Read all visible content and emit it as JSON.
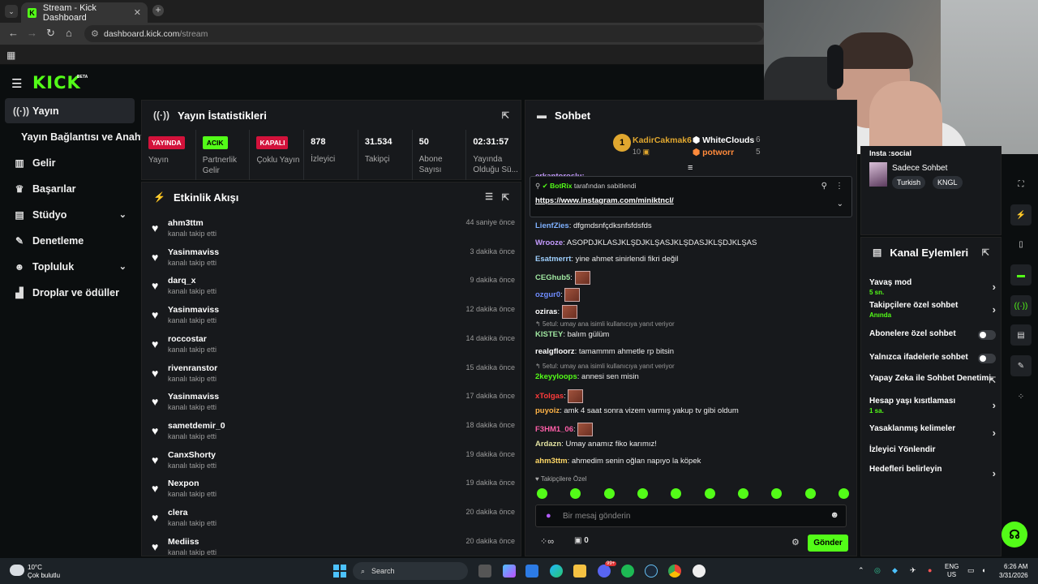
{
  "browser": {
    "tab_title": "Stream - Kick Dashboard",
    "url_host": "dashboard.kick.com",
    "url_path": "/stream"
  },
  "kick": {
    "logo": "KICK",
    "beta": "BETA"
  },
  "sidebar": {
    "items": [
      {
        "label": "Yayın",
        "icon": "broadcast-icon"
      },
      {
        "label": "Yayın Bağlantısı ve Anahtarı",
        "icon": ""
      },
      {
        "label": "Gelir",
        "icon": "chart-icon"
      },
      {
        "label": "Başarılar",
        "icon": "trophy-icon"
      },
      {
        "label": "Stüdyo",
        "icon": "studio-icon"
      },
      {
        "label": "Denetleme",
        "icon": "wrench-icon"
      },
      {
        "label": "Topluluk",
        "icon": "people-icon"
      },
      {
        "label": "Droplar ve ödüller",
        "icon": "gift-icon"
      }
    ]
  },
  "stats_panel": {
    "title": "Yayın İstatistikleri",
    "items": [
      {
        "badge": "YAYINDA",
        "label": "Yayın"
      },
      {
        "badge": "ACIK",
        "label": "Partnerlik Gelir"
      },
      {
        "badge": "KAPALI",
        "label": "Çoklu Yayın"
      },
      {
        "value": "878",
        "label": "İzleyici"
      },
      {
        "value": "31.534",
        "label": "Takipçi"
      },
      {
        "value": "50",
        "label": "Abone Sayısı"
      },
      {
        "value": "02:31:57",
        "label": "Yayında Olduğu Sü..."
      }
    ]
  },
  "activity": {
    "title": "Etkinlik Akışı",
    "items": [
      {
        "name": "ahm3ttm",
        "action": "kanalı takip etti",
        "time": "44 saniye önce"
      },
      {
        "name": "Yasinmaviss",
        "action": "kanalı takip etti",
        "time": "3 dakika önce"
      },
      {
        "name": "darq_x",
        "action": "kanalı takip etti",
        "time": "9 dakika önce"
      },
      {
        "name": "Yasinmaviss",
        "action": "kanalı takip etti",
        "time": "12 dakika önce"
      },
      {
        "name": "roccostar",
        "action": "kanalı takip etti",
        "time": "14 dakika önce"
      },
      {
        "name": "rivenranstor",
        "action": "kanalı takip etti",
        "time": "15 dakika önce"
      },
      {
        "name": "Yasinmaviss",
        "action": "kanalı takip etti",
        "time": "17 dakika önce"
      },
      {
        "name": "sametdemir_0",
        "action": "kanalı takip etti",
        "time": "18 dakika önce"
      },
      {
        "name": "CanxShorty",
        "action": "kanalı takip etti",
        "time": "19 dakika önce"
      },
      {
        "name": "Nexpon",
        "action": "kanalı takip etti",
        "time": "19 dakika önce"
      },
      {
        "name": "clera",
        "action": "kanalı takip etti",
        "time": "20 dakika önce"
      },
      {
        "name": "Mediiss",
        "action": "kanalı takip etti",
        "time": "20 dakika önce"
      }
    ]
  },
  "chat": {
    "title": "Sohbet",
    "top_gifters": [
      {
        "rank": "1",
        "name": "KadirCakmak6",
        "count": "10"
      },
      {
        "name": "WhiteClouds",
        "count": "6"
      },
      {
        "name": "potworr",
        "count": "5"
      }
    ],
    "partial_user": "erkantoroslu:",
    "pinned": {
      "author": "BotRix",
      "suffix": "tarafından sabitlendi",
      "link": "https://www.instagram.com/miniktncl/"
    },
    "messages": [
      {
        "user": "LienfZies",
        "color": "#7fb1ff",
        "text": "dfgmdsnfçdksnfsfdsfds"
      },
      {
        "user": "Wrooze",
        "color": "#c59bff",
        "text": "ASOPDJKLASJKLŞDJKLŞASJKLŞDASJKLŞDJKLŞAS"
      },
      {
        "user": "Esatmerrt",
        "color": "#9fd0ff",
        "text": "yine ahmet sinirlendi fikri değil"
      },
      {
        "user": "CEGhub5",
        "color": "#9fe6a0",
        "text": ""
      },
      {
        "user": "ozgur0",
        "color": "#6f8cff",
        "text": ""
      },
      {
        "user": "oziras",
        "color": "#ffffff",
        "text": ""
      },
      {
        "reply": "5etul: umay ana isimli kullanıcıya yanıt veriyor"
      },
      {
        "user": "KISTEY",
        "color": "#9fe6a0",
        "text": "balım gülüm"
      },
      {
        "user": "realgfloorz",
        "color": "#ffffff",
        "text": "tamammm ahmetle rp bitsin"
      },
      {
        "reply": "5etul: umay ana isimli kullanıcıya yanıt veriyor"
      },
      {
        "user": "2keyyloops",
        "color": "#53fc18",
        "text": "annesi sen misin"
      },
      {
        "user": "xTolgas",
        "color": "#ff3b3b",
        "text": ""
      },
      {
        "user": "puyoiz",
        "color": "#ffb347",
        "text": "amk 4 saat sonra vizem varmış yakup tv gibi oldum"
      },
      {
        "user": "F3HM1_06",
        "color": "#ff5fa8",
        "text": ""
      },
      {
        "user": "Ardazn",
        "color": "#e0e0a0",
        "text": "Umay anamız fiko karımız!"
      },
      {
        "user": "ahm3ttm",
        "color": "#ffd866",
        "text": "ahmedim senin oğlan napıyo la köpek"
      }
    ],
    "followers_only": "Takipçilere Özel",
    "input_placeholder": "Bir mesaj gönderin",
    "count": "0",
    "send_label": "Gönder"
  },
  "profile": {
    "partial_title": "Insta :social",
    "title": "Sadece Sohbet",
    "tags": [
      "Turkish",
      "KNGL"
    ]
  },
  "channel_actions": {
    "title": "Kanal Eylemleri",
    "items": [
      {
        "label": "Yavaş mod",
        "sub": "5 sn.",
        "control": "chevron"
      },
      {
        "label": "Takipçilere özel sohbet",
        "sub": "Anında",
        "control": "chevron"
      },
      {
        "label": "Abonelere özel sohbet",
        "sub": "",
        "control": "toggle"
      },
      {
        "label": "Yalnızca ifadelerle sohbet",
        "sub": "",
        "control": "toggle"
      },
      {
        "label": "Yapay Zeka ile Sohbet Denetimi",
        "sub": "",
        "control": "external"
      },
      {
        "label": "Hesap yaşı kısıtlaması",
        "sub": "1 sa.",
        "control": "chevron"
      },
      {
        "label": "Yasaklanmış kelimeler",
        "sub": "",
        "control": "chevron"
      },
      {
        "label": "İzleyici Yönlendir",
        "sub": "",
        "control": "none"
      },
      {
        "label": "Hedefleri belirleyin",
        "sub": "",
        "control": "chevron"
      }
    ]
  },
  "taskbar": {
    "weather_temp": "10°C",
    "weather_text": "Çok bulutlu",
    "search": "Search",
    "lang": "ENG",
    "region": "US",
    "time": "6:26 AM",
    "date": "3/31/2026",
    "badge": "99+"
  },
  "colors": {
    "brand": "#53fc18",
    "live": "#d3123b",
    "panel": "#17191c"
  }
}
